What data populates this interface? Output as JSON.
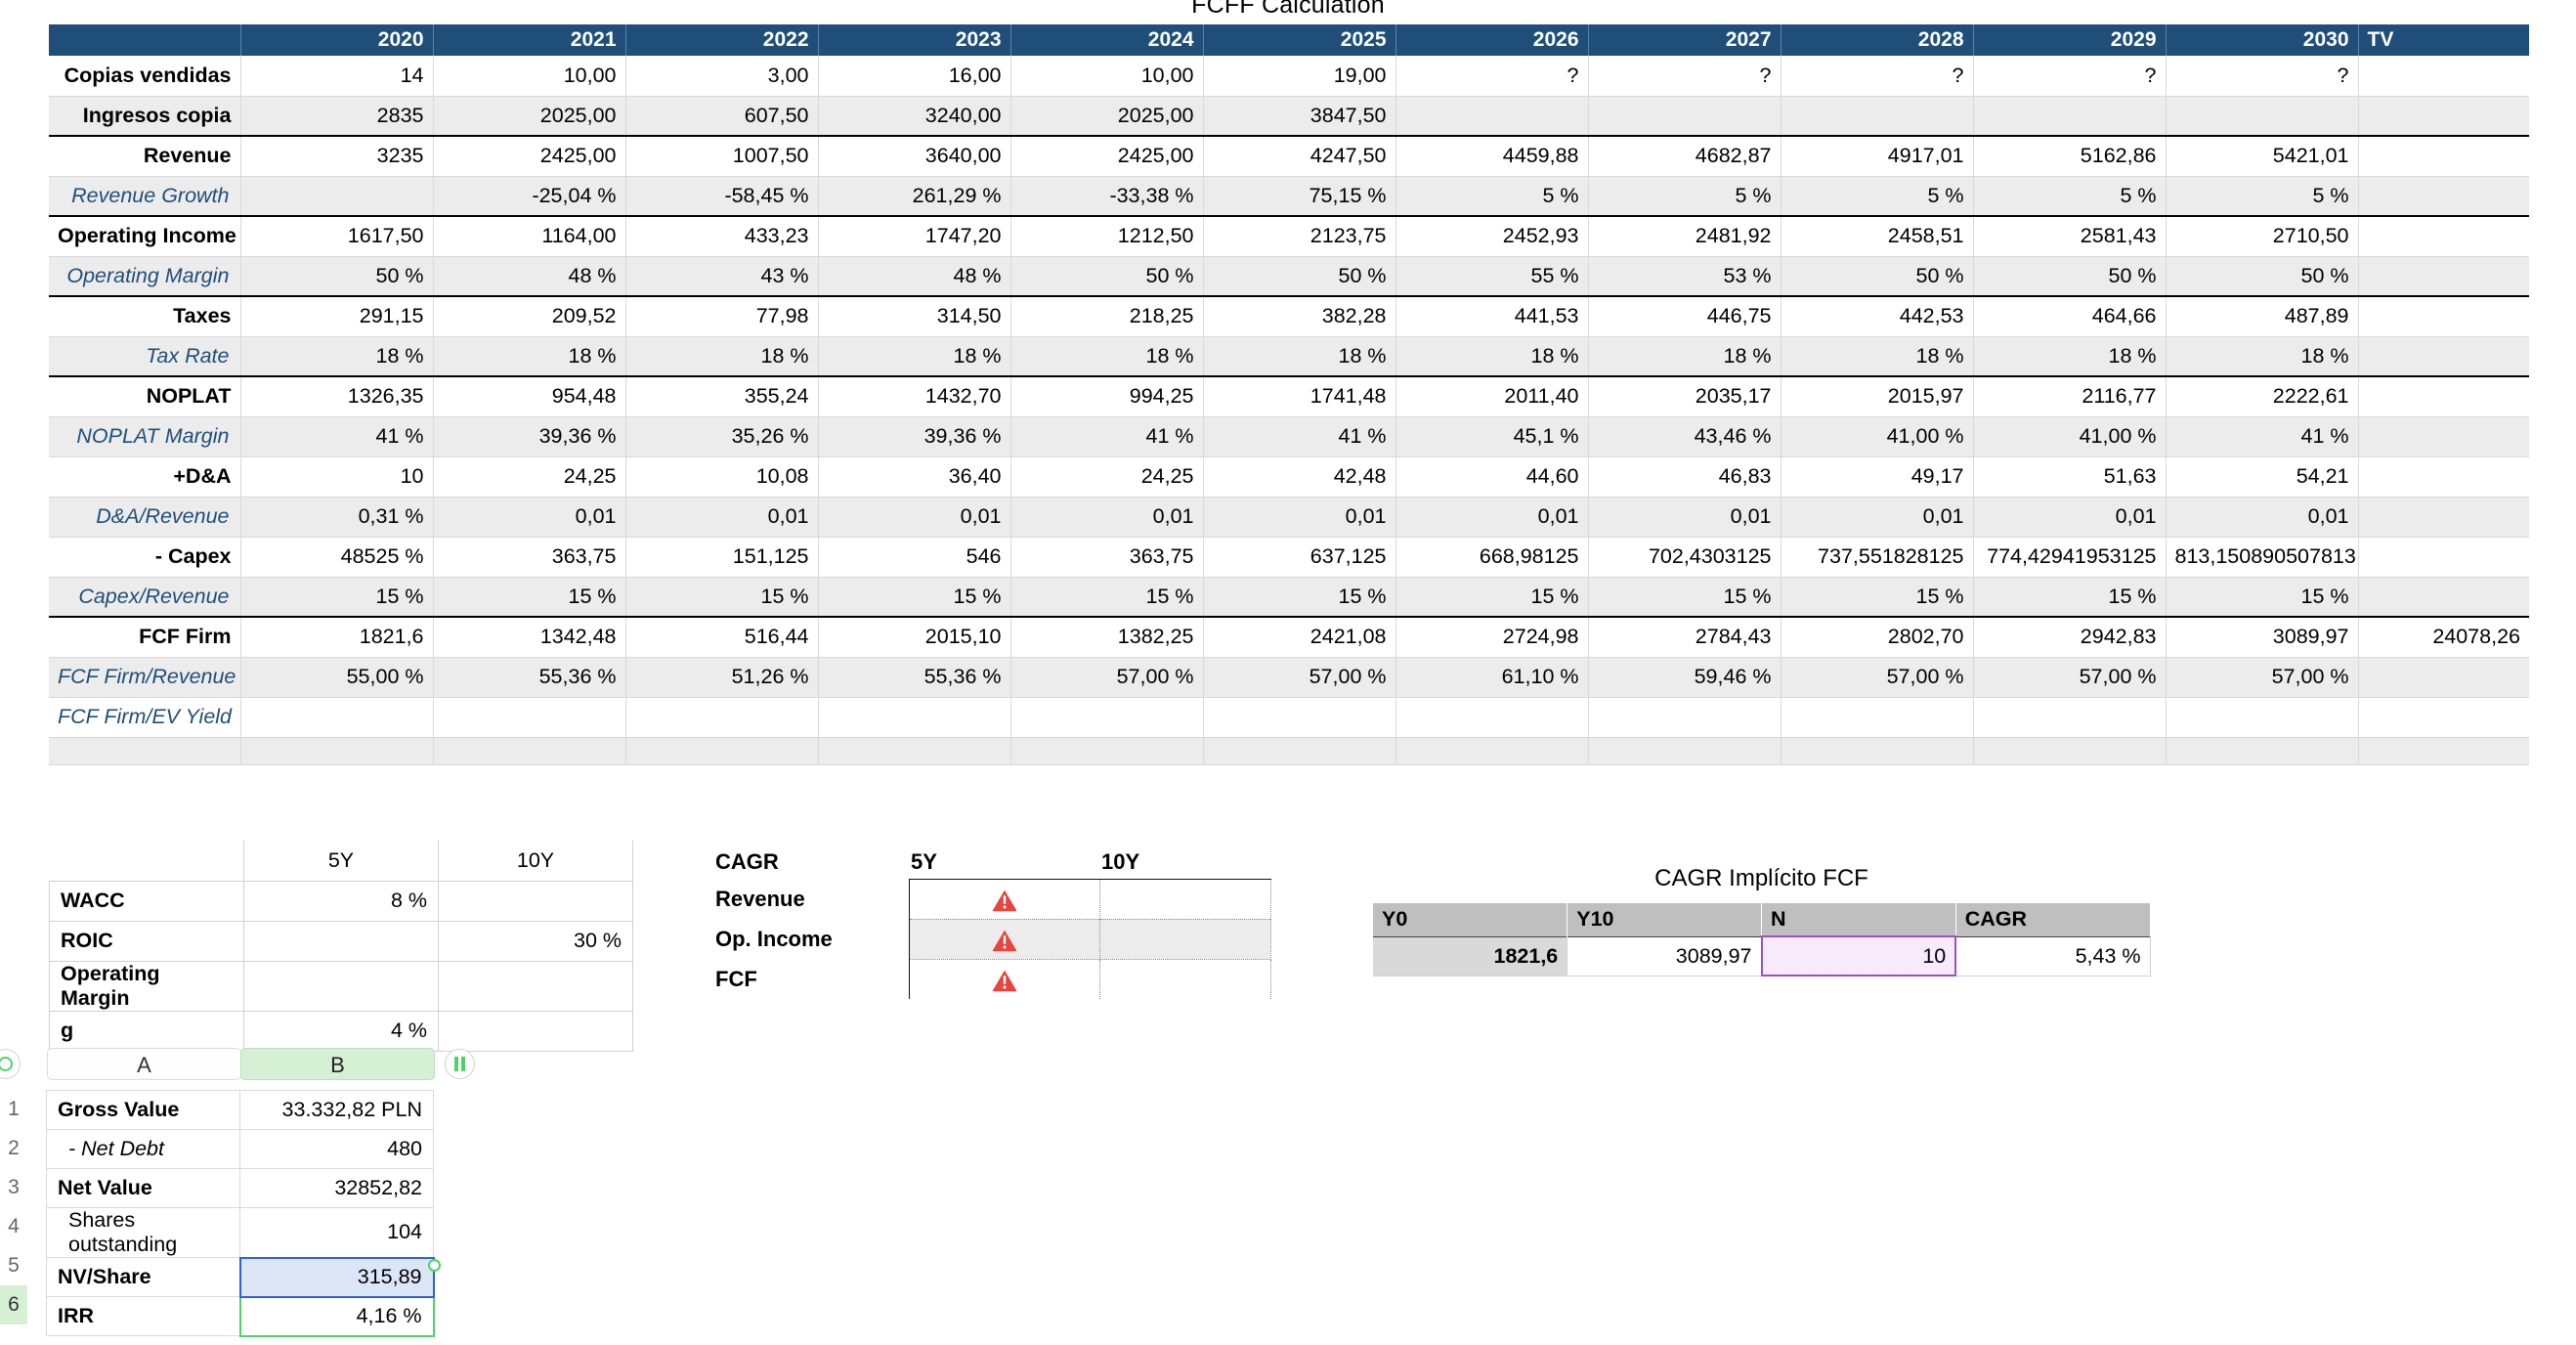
{
  "fcff": {
    "title": "FCFF Calculation",
    "columns": [
      "",
      "2020",
      "2021",
      "2022",
      "2023",
      "2024",
      "2025",
      "2026",
      "2027",
      "2028",
      "2029",
      "2030",
      "TV"
    ],
    "rows": [
      {
        "label": "Copias vendidas",
        "kind": "main",
        "values": [
          "14",
          "10,00",
          "3,00",
          "16,00",
          "10,00",
          "19,00",
          "?",
          "?",
          "?",
          "?",
          "?",
          ""
        ],
        "qmark_from": 6
      },
      {
        "label": "Ingresos copia",
        "kind": "sub-shade",
        "values": [
          "2835",
          "2025,00",
          "607,50",
          "3240,00",
          "2025,00",
          "3847,50",
          "",
          "",
          "",
          "",
          "",
          ""
        ]
      },
      {
        "label": "Revenue",
        "kind": "main-top",
        "values": [
          "3235",
          "2425,00",
          "1007,50",
          "3640,00",
          "2425,00",
          "4247,50",
          "4459,88",
          "4682,87",
          "4917,01",
          "5162,86",
          "5421,01",
          ""
        ]
      },
      {
        "label": "Revenue Growth",
        "kind": "italic-shade",
        "values": [
          "",
          "-25,04 %",
          "-58,45 %",
          "261,29 %",
          "-33,38 %",
          "75,15 %",
          "5 %",
          "5 %",
          "5 %",
          "5 %",
          "5 %",
          ""
        ]
      },
      {
        "label": "Operating Income",
        "kind": "main-top",
        "values": [
          "1617,50",
          "1164,00",
          "433,23",
          "1747,20",
          "1212,50",
          "2123,75",
          "2452,93",
          "2481,92",
          "2458,51",
          "2581,43",
          "2710,50",
          ""
        ]
      },
      {
        "label": "Operating Margin",
        "kind": "italic-shade",
        "values": [
          "50 %",
          "48 %",
          "43 %",
          "48 %",
          "50 %",
          "50 %",
          "55 %",
          "53 %",
          "50 %",
          "50 %",
          "50 %",
          ""
        ]
      },
      {
        "label": "Taxes",
        "kind": "main-top",
        "values": [
          "291,15",
          "209,52",
          "77,98",
          "314,50",
          "218,25",
          "382,28",
          "441,53",
          "446,75",
          "442,53",
          "464,66",
          "487,89",
          ""
        ]
      },
      {
        "label": "Tax Rate",
        "kind": "italic-shade",
        "values": [
          "18 %",
          "18 %",
          "18 %",
          "18 %",
          "18 %",
          "18 %",
          "18 %",
          "18 %",
          "18 %",
          "18 %",
          "18 %",
          ""
        ]
      },
      {
        "label": "NOPLAT",
        "kind": "main-top",
        "values": [
          "1326,35",
          "954,48",
          "355,24",
          "1432,70",
          "994,25",
          "1741,48",
          "2011,40",
          "2035,17",
          "2015,97",
          "2116,77",
          "2222,61",
          ""
        ]
      },
      {
        "label": "NOPLAT Margin",
        "kind": "italic-shade",
        "values": [
          "41 %",
          "39,36 %",
          "35,26 %",
          "39,36 %",
          "41 %",
          "41 %",
          "45,1 %",
          "43,46 %",
          "41,00 %",
          "41,00 %",
          "41 %",
          ""
        ]
      },
      {
        "label": "+D&A",
        "kind": "main",
        "values": [
          "10",
          "24,25",
          "10,08",
          "36,40",
          "24,25",
          "42,48",
          "44,60",
          "46,83",
          "49,17",
          "51,63",
          "54,21",
          ""
        ]
      },
      {
        "label": "D&A/Revenue",
        "kind": "italic-shade",
        "values": [
          "0,31 %",
          "0,01",
          "0,01",
          "0,01",
          "0,01",
          "0,01",
          "0,01",
          "0,01",
          "0,01",
          "0,01",
          "0,01",
          ""
        ]
      },
      {
        "label": "- Capex",
        "kind": "main",
        "values": [
          "48525 %",
          "363,75",
          "151,125",
          "546",
          "363,75",
          "637,125",
          "668,98125",
          "702,4303125",
          "737,551828125",
          "774,42941953125",
          "813,150890507813",
          ""
        ]
      },
      {
        "label": "Capex/Revenue",
        "kind": "italic-shade",
        "values": [
          "15 %",
          "15 %",
          "15 %",
          "15 %",
          "15 %",
          "15 %",
          "15 %",
          "15 %",
          "15 %",
          "15 %",
          "15 %",
          ""
        ]
      },
      {
        "label": "FCF Firm",
        "kind": "main-top",
        "values": [
          "1821,6",
          "1342,48",
          "516,44",
          "2015,10",
          "1382,25",
          "2421,08",
          "2724,98",
          "2784,43",
          "2802,70",
          "2942,83",
          "3089,97",
          "24078,26"
        ]
      },
      {
        "label": "FCF Firm/Revenue",
        "kind": "italic-shade",
        "values": [
          "55,00 %",
          "55,36 %",
          "51,26 %",
          "55,36 %",
          "57,00 %",
          "57,00 %",
          "61,10 %",
          "59,46 %",
          "57,00 %",
          "57,00 %",
          "57,00 %",
          ""
        ]
      },
      {
        "label": "FCF Firm/EV Yield",
        "kind": "italic",
        "values": [
          "",
          "",
          "",
          "",
          "",
          "",
          "",
          "",
          "",
          "",
          "",
          ""
        ]
      },
      {
        "label": "",
        "kind": "spacer-shade",
        "values": [
          "",
          "",
          "",
          "",
          "",
          "",
          "",
          "",
          "",
          "",
          "",
          ""
        ]
      }
    ]
  },
  "wacc": {
    "headers": [
      "",
      "5Y",
      "10Y"
    ],
    "rows": [
      {
        "label": "WACC",
        "y5": "8 %",
        "y10": ""
      },
      {
        "label": "ROIC",
        "y5": "",
        "y10": "30 %"
      },
      {
        "label": "Operating Margin",
        "y5": "",
        "y10": ""
      },
      {
        "label": "g",
        "y5": "4 %",
        "y10": ""
      }
    ]
  },
  "cagr": {
    "headers": [
      "CAGR",
      "5Y",
      "10Y"
    ],
    "rows": [
      {
        "label": "Revenue",
        "y5": "warning-icon",
        "y10": ""
      },
      {
        "label": "Op. Income",
        "y5": "warning-icon",
        "y10": ""
      },
      {
        "label": "FCF",
        "y5": "warning-icon",
        "y10": ""
      }
    ],
    "warning_color": "#e8453c"
  },
  "implicit": {
    "title": "CAGR Implícito FCF",
    "headers": [
      "Y0",
      "Y10",
      "N",
      "CAGR"
    ],
    "values": [
      "1821,6",
      "3089,97",
      "10",
      "5,43 %"
    ],
    "selected_cell_color": "#9b51c4"
  },
  "sheet": {
    "columns": [
      "A",
      "B"
    ],
    "selected_column": "B",
    "row_numbers": [
      "1",
      "2",
      "3",
      "4",
      "5",
      "6"
    ],
    "selected_row": "6",
    "rows": [
      {
        "key": "Gross Value",
        "value": "33.332,82 PLN",
        "style": "bold"
      },
      {
        "key": "- Net Debt",
        "value": "480",
        "style": "indent-italic"
      },
      {
        "key": "Net Value",
        "value": "32852,82",
        "style": "bold"
      },
      {
        "key": "Shares outstanding",
        "value": "104",
        "style": "indent"
      },
      {
        "key": "NV/Share",
        "value": "315,89",
        "style": "bold",
        "sel": "blue"
      },
      {
        "key": "IRR",
        "value": "4,16 %",
        "style": "bold",
        "sel": "green"
      }
    ],
    "left_control": "record-circle-icon",
    "right_control": "pause-icon",
    "accent_green": "#4cd364",
    "accent_blue": "#2b62d9"
  }
}
